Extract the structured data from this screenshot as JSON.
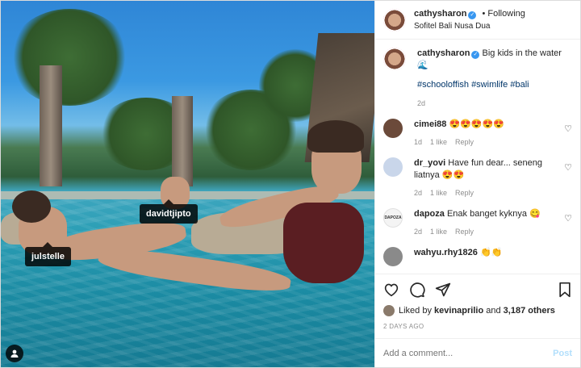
{
  "post": {
    "author": "cathysharon",
    "follow_status": "Following",
    "location": "Sofitel Bali Nusa Dua",
    "verified_glyph": "✓"
  },
  "photo_tags": [
    "davidtjipto",
    "julstelle"
  ],
  "caption": {
    "author": "cathysharon",
    "text": "Big kids in the water 🌊",
    "hashtags": "#schooloffish #swimlife #bali",
    "age": "2d"
  },
  "comments": [
    {
      "author": "cimei88",
      "text": "😍😍😍😍😍",
      "age": "1d",
      "likes": "1 like",
      "reply": "Reply",
      "avatar_color": "#6b4a3a"
    },
    {
      "author": "dr_yovi",
      "text": "Have fun dear... seneng liatnya 😍😍",
      "age": "2d",
      "likes": "1 like",
      "reply": "Reply",
      "avatar_color": "#c9d6ea"
    },
    {
      "author": "dapoza",
      "text": "Enak banget kyknya 😋",
      "age": "2d",
      "likes": "1 like",
      "reply": "Reply",
      "avatar_text": "DAPOZA",
      "avatar_color": "#f4f4f4"
    },
    {
      "author": "wahyu.rhy1826",
      "text": "👏👏",
      "age": "",
      "likes": "",
      "reply": "",
      "avatar_color": "#8a8a8a"
    }
  ],
  "likes": {
    "liked_by_label": "Liked by",
    "liked_by_user": "kevinaprilio",
    "and_label": "and",
    "others": "3,187 others"
  },
  "timestamp": "2 DAYS AGO",
  "comment_box": {
    "placeholder": "Add a comment...",
    "post_label": "Post"
  },
  "icons": [
    "heart-icon",
    "comment-icon",
    "share-icon",
    "bookmark-icon",
    "user-tag-icon"
  ]
}
